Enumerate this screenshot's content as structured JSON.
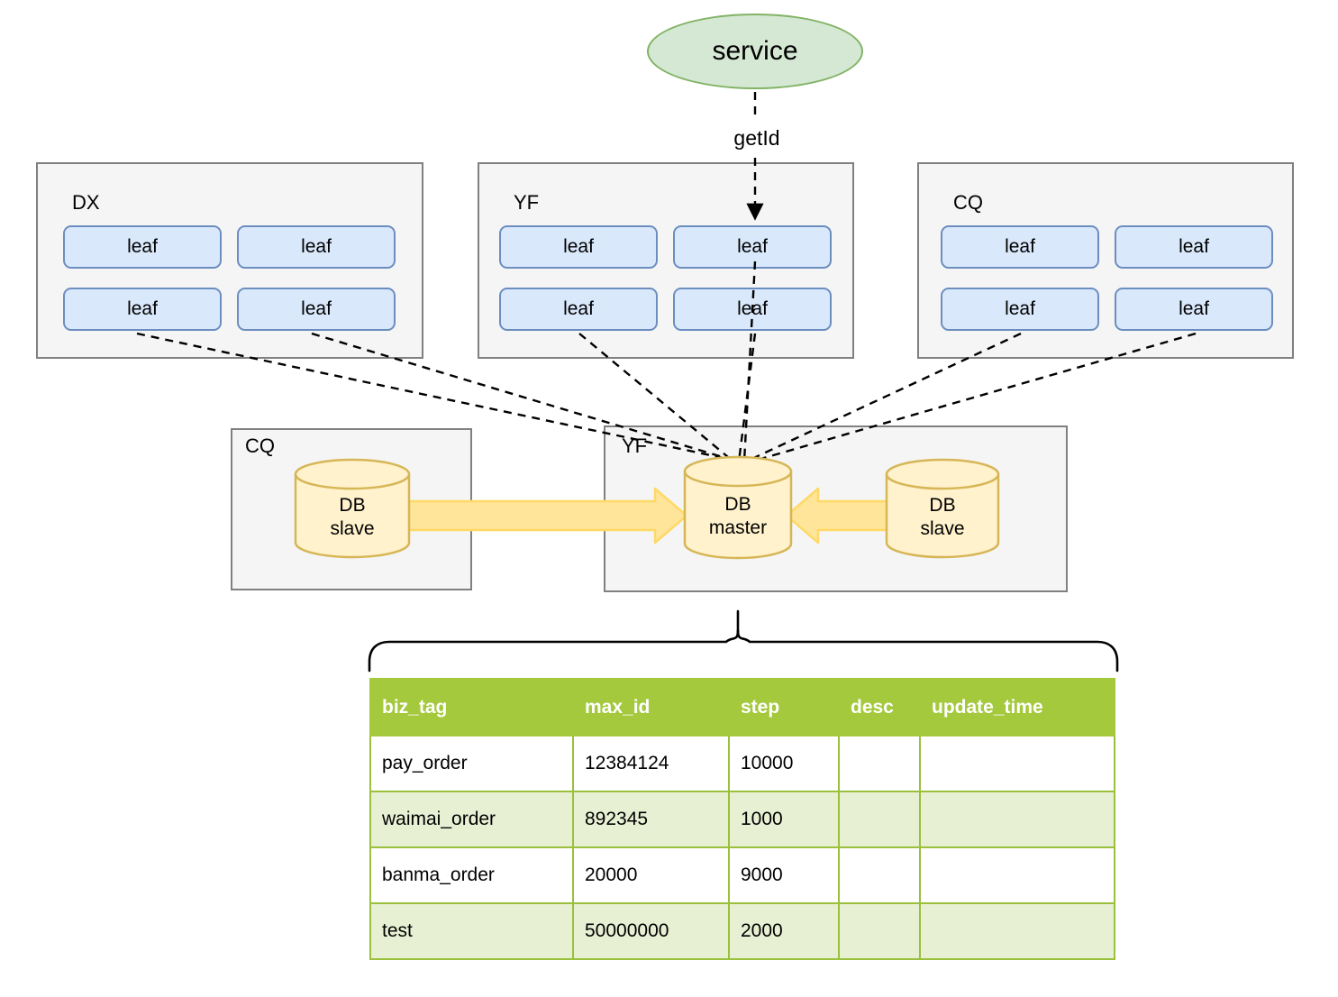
{
  "diagram": {
    "service": {
      "label": "service"
    },
    "call": {
      "label": "getId"
    },
    "leaf_regions": [
      {
        "name": "DX",
        "leaves": [
          {
            "label": "leaf"
          },
          {
            "label": "leaf"
          },
          {
            "label": "leaf"
          },
          {
            "label": "leaf"
          }
        ]
      },
      {
        "name": "YF",
        "leaves": [
          {
            "label": "leaf"
          },
          {
            "label": "leaf"
          },
          {
            "label": "leaf"
          },
          {
            "label": "leaf"
          }
        ]
      },
      {
        "name": "CQ",
        "leaves": [
          {
            "label": "leaf"
          },
          {
            "label": "leaf"
          },
          {
            "label": "leaf"
          },
          {
            "label": "leaf"
          }
        ]
      }
    ],
    "db_regions": [
      {
        "name": "CQ",
        "databases": [
          {
            "line1": "DB",
            "line2": "slave"
          }
        ]
      },
      {
        "name": "YF",
        "databases": [
          {
            "line1": "DB",
            "line2": "master"
          },
          {
            "line1": "DB",
            "line2": "slave"
          }
        ]
      }
    ],
    "colors": {
      "service_fill": "#d5e8d4",
      "service_stroke": "#82b366",
      "leaf_fill": "#dae8fc",
      "leaf_stroke": "#6c8ebf",
      "region_fill": "#f5f5f5",
      "region_stroke": "#808080",
      "db_fill": "#fff2cc",
      "db_stroke": "#d6b656",
      "replication_arrow": "#ffe599",
      "table_header": "#a4c93c",
      "table_row_alt": "#e8f0d4"
    }
  },
  "table": {
    "columns": [
      "biz_tag",
      "max_id",
      "step",
      "desc",
      "update_time"
    ],
    "rows": [
      {
        "biz_tag": "pay_order",
        "max_id": "12384124",
        "step": "10000",
        "desc": "",
        "update_time": ""
      },
      {
        "biz_tag": "waimai_order",
        "max_id": "892345",
        "step": "1000",
        "desc": "",
        "update_time": ""
      },
      {
        "biz_tag": "banma_order",
        "max_id": "20000",
        "step": "9000",
        "desc": "",
        "update_time": ""
      },
      {
        "biz_tag": "test",
        "max_id": "50000000",
        "step": "2000",
        "desc": "",
        "update_time": ""
      }
    ]
  }
}
